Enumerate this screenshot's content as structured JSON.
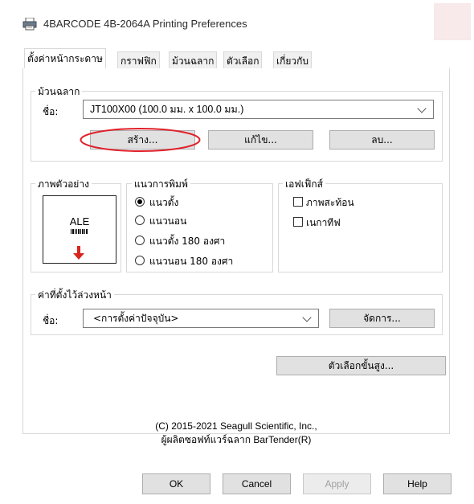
{
  "window": {
    "title": "4BARCODE 4B-2064A Printing Preferences",
    "icon": "printer-icon"
  },
  "tabs": [
    {
      "label": "ตั้งค่าหน้ากระดาษ",
      "active": true
    },
    {
      "label": "กราฟฟิก",
      "active": false
    },
    {
      "label": "ม้วนฉลาก",
      "active": false
    },
    {
      "label": "ตัวเลือก",
      "active": false
    },
    {
      "label": "เกี่ยวกับ",
      "active": false
    }
  ],
  "stock": {
    "group_label": "ม้วนฉลาก",
    "name_label": "ชื่อ:",
    "name_value": "JT100X00 (100.0 มม. x 100.0 มม.)",
    "new_button": "สร้าง...",
    "edit_button": "แก้ไข...",
    "delete_button": "ลบ...",
    "highlight_color": "#e0212b"
  },
  "preview": {
    "group_label": "ภาพตัวอย่าง",
    "sample_text": "ALE",
    "arrow_color": "#d7261e"
  },
  "orientation": {
    "group_label": "แนวการพิมพ์",
    "options": [
      {
        "label": "แนวตั้ง",
        "selected": true
      },
      {
        "label": "แนวนอน",
        "selected": false
      },
      {
        "label": "แนวตั้ง 180 องศา",
        "selected": false
      },
      {
        "label": "แนวนอน 180 องศา",
        "selected": false
      }
    ]
  },
  "effects": {
    "group_label": "เอฟเฟ็กส์",
    "options": [
      {
        "label": "ภาพสะท้อน",
        "checked": false
      },
      {
        "label": "เนกาทีฟ",
        "checked": false
      }
    ]
  },
  "presets": {
    "group_label": "ค่าที่ตั้งไว้ล่วงหน้า",
    "name_label": "ชื่อ:",
    "value": "<การตั้งค่าปัจจุบัน>",
    "manage_button": "จัดการ..."
  },
  "advanced_button": "ตัวเลือกขั้นสูง...",
  "copyright": {
    "line1": "(C) 2015-2021 Seagull Scientific, Inc.,",
    "line2": "ผู้ผลิตซอฟท์แวร์ฉลาก BarTender(R)"
  },
  "footer": {
    "ok": "OK",
    "cancel": "Cancel",
    "apply": "Apply",
    "help": "Help"
  }
}
